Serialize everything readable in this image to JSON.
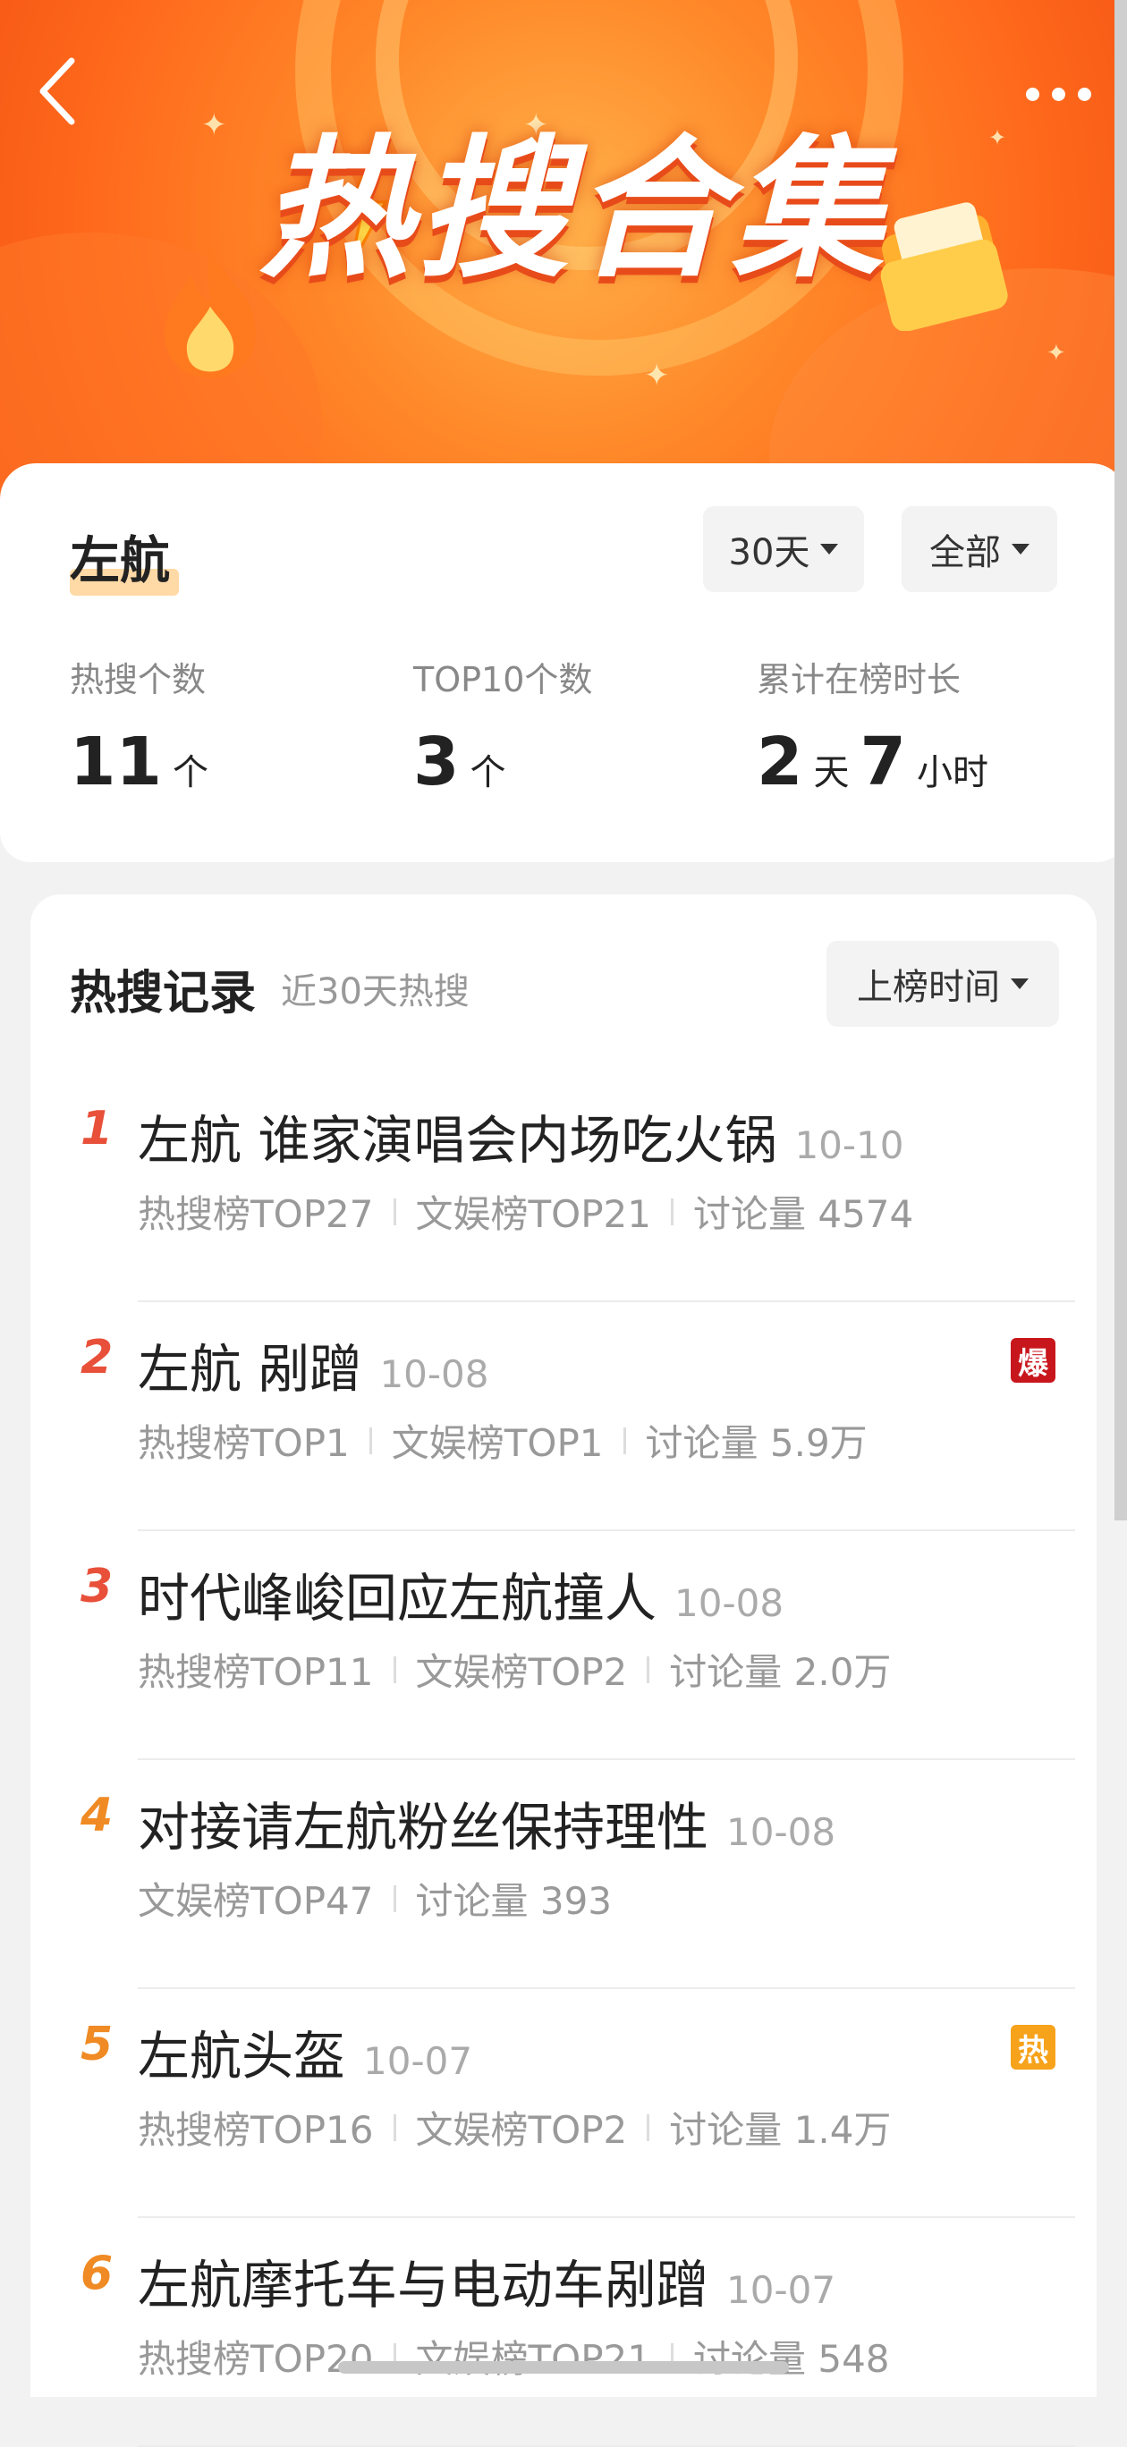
{
  "header": {
    "title": "热搜合集",
    "back_icon": "back-arrow-icon",
    "more_icon": "more-dots-icon"
  },
  "summary": {
    "keyword": "左航",
    "range_filter": "30天",
    "type_filter": "全部",
    "stats": [
      {
        "label": "热搜个数",
        "value": "11",
        "unit": "个"
      },
      {
        "label": "TOP10个数",
        "value": "3",
        "unit": "个"
      },
      {
        "label": "累计在榜时长",
        "value_days": "2",
        "unit_days": "天",
        "value_hours": "7",
        "unit_hours": "小时"
      }
    ]
  },
  "records": {
    "title": "热搜记录",
    "subtitle": "近30天热搜",
    "sort_label": "上榜时间",
    "items": [
      {
        "rank": "1",
        "title": "左航 谁家演唱会内场吃火锅",
        "date": "10-10",
        "meta": [
          "热搜榜TOP27",
          "文娱榜TOP21",
          "讨论量 4574"
        ],
        "badge": ""
      },
      {
        "rank": "2",
        "title": "左航 剐蹭",
        "date": "10-08",
        "meta": [
          "热搜榜TOP1",
          "文娱榜TOP1",
          "讨论量 5.9万"
        ],
        "badge": "爆"
      },
      {
        "rank": "3",
        "title": "时代峰峻回应左航撞人",
        "date": "10-08",
        "meta": [
          "热搜榜TOP11",
          "文娱榜TOP2",
          "讨论量 2.0万"
        ],
        "badge": ""
      },
      {
        "rank": "4",
        "title": "对接请左航粉丝保持理性",
        "date": "10-08",
        "meta": [
          "文娱榜TOP47",
          "讨论量 393"
        ],
        "badge": ""
      },
      {
        "rank": "5",
        "title": "左航头盔",
        "date": "10-07",
        "meta": [
          "热搜榜TOP16",
          "文娱榜TOP2",
          "讨论量 1.4万"
        ],
        "badge": "热"
      },
      {
        "rank": "6",
        "title": "左航摩托车与电动车剐蹭",
        "date": "10-07",
        "meta": [
          "热搜榜TOP20",
          "文娱榜TOP21",
          "讨论量 548"
        ],
        "badge": ""
      }
    ]
  },
  "colors": {
    "rank_top": "#e8503a",
    "rank_other": "#f08a24",
    "badge_bao": "#c8161d",
    "badge_re": "#f7a21b"
  }
}
